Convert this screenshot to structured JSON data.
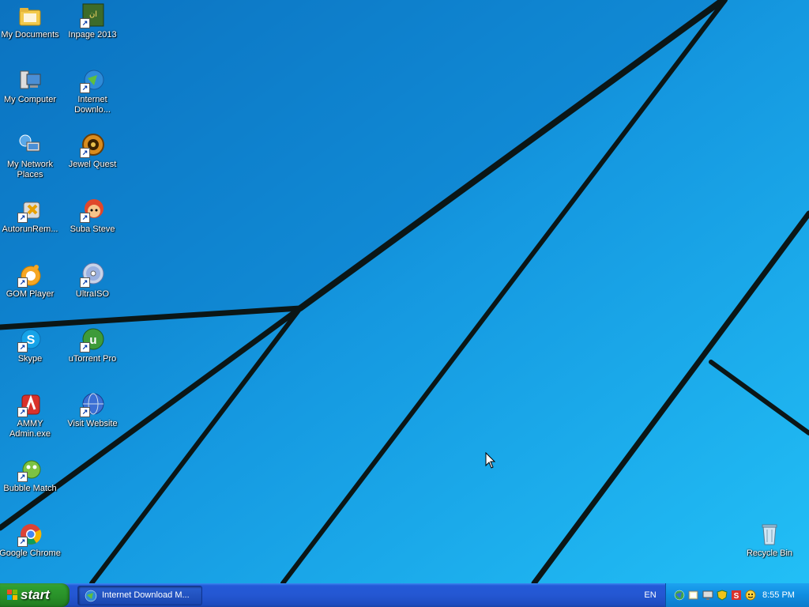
{
  "desktop": {
    "icons": [
      {
        "label": "My Documents",
        "icon": "folder-icon"
      },
      {
        "label": "Inpage 2013",
        "icon": "inpage-icon"
      },
      {
        "label": "My Computer",
        "icon": "computer-icon"
      },
      {
        "label": "Internet\nDownlo...",
        "icon": "internet-download-manager-icon"
      },
      {
        "label": "My Network\nPlaces",
        "icon": "network-places-icon"
      },
      {
        "label": "Jewel Quest",
        "icon": "jewel-quest-icon"
      },
      {
        "label": "AutorunRem...",
        "icon": "autorun-remover-icon"
      },
      {
        "label": "Suba Steve",
        "icon": "game-character-icon"
      },
      {
        "label": "GOM Player",
        "icon": "gom-player-icon"
      },
      {
        "label": "UltraISO",
        "icon": "disc-icon"
      },
      {
        "label": "Skype",
        "icon": "skype-icon"
      },
      {
        "label": "uTorrent Pro",
        "icon": "utorrent-icon"
      },
      {
        "label": "AMMY\nAdmin.exe",
        "icon": "ammy-admin-icon"
      },
      {
        "label": "Visit Website",
        "icon": "globe-icon"
      },
      {
        "label": "Bubble Match",
        "icon": "bubble-match-icon"
      },
      {
        "label": "Google Chrome",
        "icon": "chrome-icon"
      },
      {
        "label": "Recycle Bin",
        "icon": "recycle-bin-icon"
      }
    ]
  },
  "taskbar": {
    "start_label": "start",
    "tasks": [
      {
        "label": "Internet Download M...",
        "icon": "internet-download-manager-icon"
      }
    ],
    "language": "EN",
    "tray_icons": [
      "network-globe-icon",
      "folder-sync-icon",
      "monitor-icon",
      "shield-icon",
      "security-icon",
      "smiley-icon"
    ],
    "clock": "8:55 PM"
  },
  "colors": {
    "wallpaper_blue": "#0f8ed8",
    "wallpaper_line": "#0a1a1a",
    "taskbar_blue": "#2457d2",
    "start_green": "#2f9e2f",
    "tray_blue": "#0f8de0"
  }
}
